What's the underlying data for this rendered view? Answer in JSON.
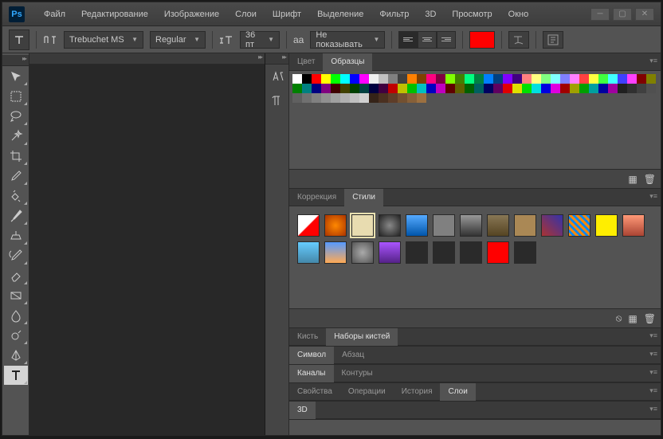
{
  "menu": [
    "Файл",
    "Редактирование",
    "Изображение",
    "Слои",
    "Шрифт",
    "Выделение",
    "Фильтр",
    "3D",
    "Просмотр",
    "Окно"
  ],
  "options": {
    "font": "Trebuchet MS",
    "fontStyle": "Regular",
    "size": "36 пт",
    "antialias": "Не показывать",
    "aaLabel": "aa",
    "color": "#ff0000"
  },
  "panels": {
    "colorTabs": [
      "Цвет",
      "Образцы"
    ],
    "correctionTabs": [
      "Коррекция",
      "Стили"
    ],
    "brushTabs": [
      "Кисть",
      "Наборы кистей"
    ],
    "charTabs": [
      "Символ",
      "Абзац"
    ],
    "channelTabs": [
      "Каналы",
      "Контуры"
    ],
    "propTabs": [
      "Свойства",
      "Операции",
      "История",
      "Слои"
    ],
    "threeDTabs": [
      "3D"
    ]
  },
  "swatches": [
    "#ffffff",
    "#000000",
    "#ff0000",
    "#ffff00",
    "#00ff00",
    "#00ffff",
    "#0000ff",
    "#ff00ff",
    "#eeeeee",
    "#c0c0c0",
    "#808080",
    "#404040",
    "#ff8000",
    "#804000",
    "#ff0080",
    "#800040",
    "#80ff00",
    "#408000",
    "#00ff80",
    "#008040",
    "#0080ff",
    "#004080",
    "#8000ff",
    "#400080",
    "#ff8080",
    "#ffff80",
    "#80ff80",
    "#80ffff",
    "#8080ff",
    "#ff80ff",
    "#ff4040",
    "#ffff40",
    "#40ff40",
    "#40ffff",
    "#4040ff",
    "#ff40ff",
    "#800000",
    "#808000",
    "#008000",
    "#008080",
    "#000080",
    "#800080",
    "#400000",
    "#404000",
    "#004000",
    "#004040",
    "#000040",
    "#400040",
    "#c00000",
    "#c0c000",
    "#00c000",
    "#00c0c0",
    "#0000c0",
    "#c000c0",
    "#600000",
    "#606000",
    "#006000",
    "#006060",
    "#000060",
    "#600060",
    "#e00000",
    "#e0e000",
    "#00e000",
    "#00e0e0",
    "#0000e0",
    "#e000e0",
    "#a00000",
    "#a0a000",
    "#00a000",
    "#00a0a0",
    "#0000a0",
    "#a000a0",
    "#202020",
    "#303030",
    "#404040",
    "#505050",
    "#606060",
    "#707070",
    "#808080",
    "#909090",
    "#a0a0a0",
    "#b0b0b0",
    "#c0c0c0",
    "#d0d0d0",
    "#352318",
    "#4a3020",
    "#5e3d28",
    "#735030",
    "#876038",
    "#9c7040"
  ],
  "styles": [
    {
      "bg": "linear-gradient(135deg,#fff 48%,#f00 52%)",
      "sel": false
    },
    {
      "bg": "radial-gradient(#ff8800,#aa3300)",
      "sel": false
    },
    {
      "bg": "#e8dcb0",
      "sel": true
    },
    {
      "bg": "radial-gradient(#888,#222)",
      "sel": false
    },
    {
      "bg": "linear-gradient(#5af,#05a)",
      "sel": false
    },
    {
      "bg": "#808080",
      "sel": false
    },
    {
      "bg": "linear-gradient(#999,#333)",
      "sel": false
    },
    {
      "bg": "linear-gradient(#887755,#554422)",
      "sel": false
    },
    {
      "bg": "#aa8855",
      "sel": false
    },
    {
      "bg": "linear-gradient(45deg,#a33,#33a)",
      "sel": false
    },
    {
      "bg": "repeating-linear-gradient(45deg,#f80,#f80 3px,#08f 3px,#08f 6px)",
      "sel": false
    },
    {
      "bg": "#ffee00",
      "sel": false
    },
    {
      "bg": "linear-gradient(#f97,#a43)",
      "sel": false
    },
    {
      "bg": "linear-gradient(#6cf,#48a)",
      "sel": false
    },
    {
      "bg": "linear-gradient(#59f,#fa5)",
      "sel": false
    },
    {
      "bg": "radial-gradient(#aaa,#555)",
      "sel": false
    },
    {
      "bg": "linear-gradient(#a5f,#528)",
      "sel": false
    },
    {
      "bg": "#2a2a2a",
      "sel": false
    },
    {
      "bg": "#2a2a2a",
      "sel": false
    },
    {
      "bg": "#2a2a2a",
      "sel": false
    },
    {
      "bg": "#ff0000",
      "sel": false
    },
    {
      "bg": "#2a2a2a",
      "sel": false
    }
  ]
}
